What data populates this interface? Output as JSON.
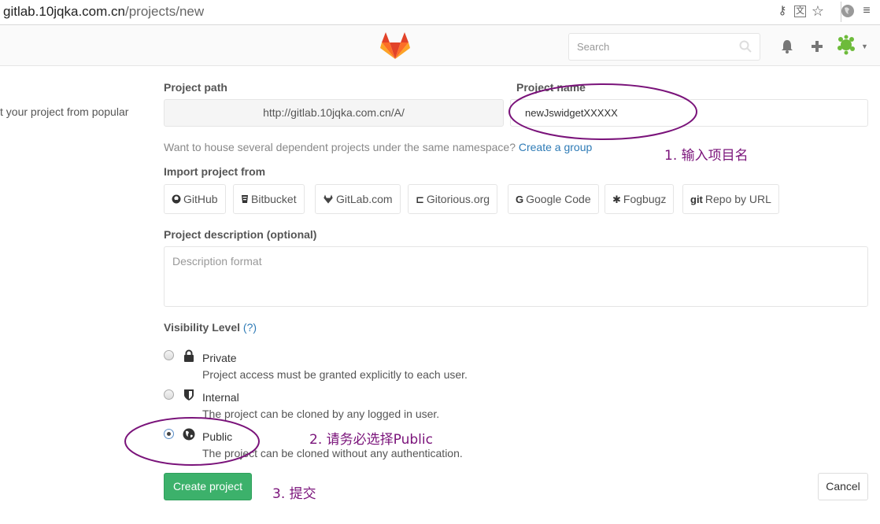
{
  "browser": {
    "url_host": "gitlab.10jqka.com.cn",
    "url_path": "/projects/new"
  },
  "header": {
    "search_placeholder": "Search",
    "brand_color": "#fc6d26"
  },
  "form": {
    "left_intro_text": "t your project from popular",
    "project_path_label": "Project path",
    "project_path_value": "http://gitlab.10jqka.com.cn/A/",
    "project_name_label": "Project name",
    "project_name_value": "newJswidgetXXXXX",
    "namespace_hint": "Want to house several dependent projects under the same namespace?",
    "create_group_link": "Create a group",
    "import_label": "Import project from",
    "import_sources": [
      {
        "label": "GitHub",
        "icon": "github-icon"
      },
      {
        "label": "Bitbucket",
        "icon": "bitbucket-icon"
      },
      {
        "label": "GitLab.com",
        "icon": "gitlab-icon"
      },
      {
        "label": "Gitorious.org",
        "icon": "gitorious-icon"
      },
      {
        "label": "Google Code",
        "icon": "google-icon"
      },
      {
        "label": "Fogbugz",
        "icon": "bug-icon"
      },
      {
        "label": "Repo by URL",
        "icon": "git-icon",
        "icon_text": "git"
      }
    ],
    "description_label": "Project description (optional)",
    "description_placeholder": "Description format",
    "visibility_label": "Visibility Level",
    "visibility_help": "(?)",
    "visibility_options": [
      {
        "title": "Private",
        "desc": "Project access must be granted explicitly to each user.",
        "icon": "lock-icon",
        "checked": false
      },
      {
        "title": "Internal",
        "desc": "The project can be cloned by any logged in user.",
        "icon": "shield-icon",
        "checked": false
      },
      {
        "title": "Public",
        "desc": "The project can be cloned without any authentication.",
        "icon": "globe-icon",
        "checked": true
      }
    ],
    "create_button": "Create project",
    "cancel_button": "Cancel"
  },
  "annotations": {
    "step1": "1. 输入项目名",
    "step2": "2. 请务必选择Public",
    "step3": "3. 提交",
    "color": "#7a137a"
  }
}
